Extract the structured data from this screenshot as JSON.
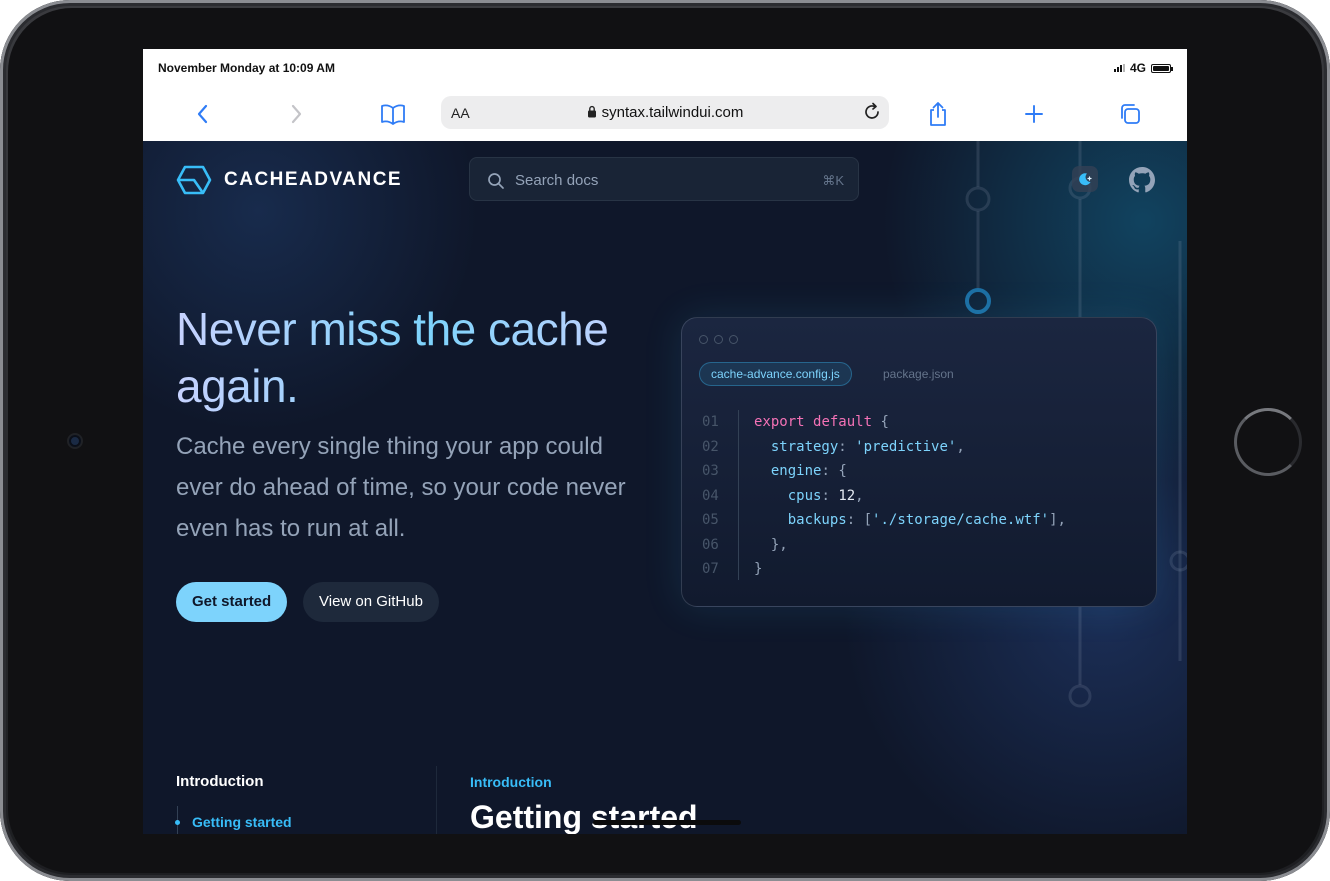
{
  "status_bar": {
    "time": "November Monday at 10:09 AM",
    "network": "4G"
  },
  "browser": {
    "text_size": "AA",
    "url": "syntax.tailwindui.com"
  },
  "site": {
    "logo_text": "CACHEADVANCE",
    "search": {
      "placeholder": "Search docs",
      "shortcut": "⌘K"
    }
  },
  "hero": {
    "title": "Never miss the cache again.",
    "subtitle": "Cache every single thing your app could ever do ahead of time, so your code never even has to run at all.",
    "primary_button": "Get started",
    "secondary_button": "View on GitHub"
  },
  "code_window": {
    "tabs": [
      "cache-advance.config.js",
      "package.json"
    ],
    "line_numbers": [
      "01",
      "02",
      "03",
      "04",
      "05",
      "06",
      "07"
    ],
    "lines": [
      "export default {",
      "  strategy: 'predictive',",
      "  engine: {",
      "    cpus: 12,",
      "    backups: ['./storage/cache.wtf'],",
      "  },",
      "}"
    ]
  },
  "sidebar": {
    "section": "Introduction",
    "items": [
      "Getting started"
    ]
  },
  "content": {
    "breadcrumb": "Introduction",
    "title": "Getting started"
  }
}
